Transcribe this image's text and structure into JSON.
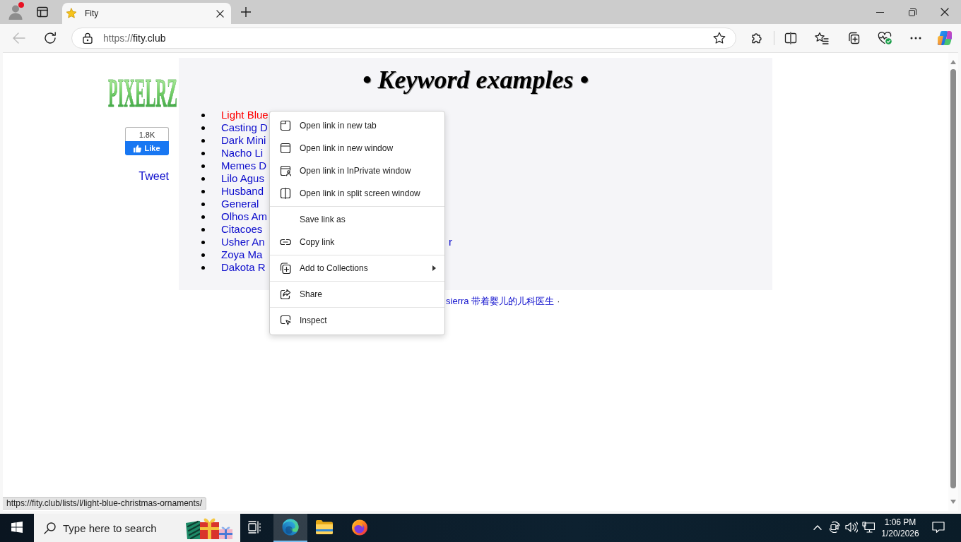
{
  "browser": {
    "profile": {
      "notification": true
    },
    "tabs": [
      {
        "title": "Fity",
        "selected": true
      }
    ],
    "back_disabled": true,
    "address_bar": {
      "scheme": "https://",
      "host": "fity.club"
    }
  },
  "page": {
    "logo": "PIXELRZ",
    "like": {
      "count": "1.8K",
      "label": "Like"
    },
    "tweet": "Tweet",
    "heading": "• Keyword examples •",
    "keywords": [
      {
        "text": "Light Blue",
        "hovered": true
      },
      {
        "text": "Casting D",
        "hovered": false
      },
      {
        "text": "Dark Mini",
        "hovered": false
      },
      {
        "text": "Nacho Li",
        "hovered": false
      },
      {
        "text": "Memes D",
        "hovered": false
      },
      {
        "text": "Lilo Agus",
        "hovered": false
      },
      {
        "text": "Husband",
        "hovered": false
      },
      {
        "text": "General",
        "hovered": false
      },
      {
        "text": "Olhos Am",
        "hovered": false
      },
      {
        "text": "Citacoes",
        "hovered": false
      },
      {
        "text": "Usher An",
        "hovered": false,
        "tail": "r"
      },
      {
        "text": "Zoya Ma",
        "hovered": false
      },
      {
        "text": "Dakota R",
        "hovered": false
      }
    ],
    "footer": {
      "link": "sierra 带着婴儿的儿科医生",
      "separator": "·"
    }
  },
  "context_menu": {
    "groups": [
      [
        {
          "label": "Open link in new tab",
          "submenu": false
        },
        {
          "label": "Open link in new window",
          "submenu": false
        },
        {
          "label": "Open link in InPrivate window",
          "submenu": false
        },
        {
          "label": "Open link in split screen window",
          "submenu": false
        }
      ],
      [
        {
          "label": "Save link as",
          "submenu": false
        },
        {
          "label": "Copy link",
          "submenu": false
        }
      ],
      [
        {
          "label": "Add to Collections",
          "submenu": true
        }
      ],
      [
        {
          "label": "Share",
          "submenu": false
        }
      ],
      [
        {
          "label": "Inspect",
          "submenu": false
        }
      ]
    ]
  },
  "status_url": "https://fity.club/lists/l/light-blue-christmas-ornaments/",
  "taskbar": {
    "search": {
      "placeholder": "Type here to search"
    },
    "apps": [
      {
        "selected": true
      },
      {
        "selected": false
      },
      {
        "selected": false
      }
    ],
    "clock": {
      "time": "1:06 PM",
      "date": "1/20/2026"
    }
  }
}
